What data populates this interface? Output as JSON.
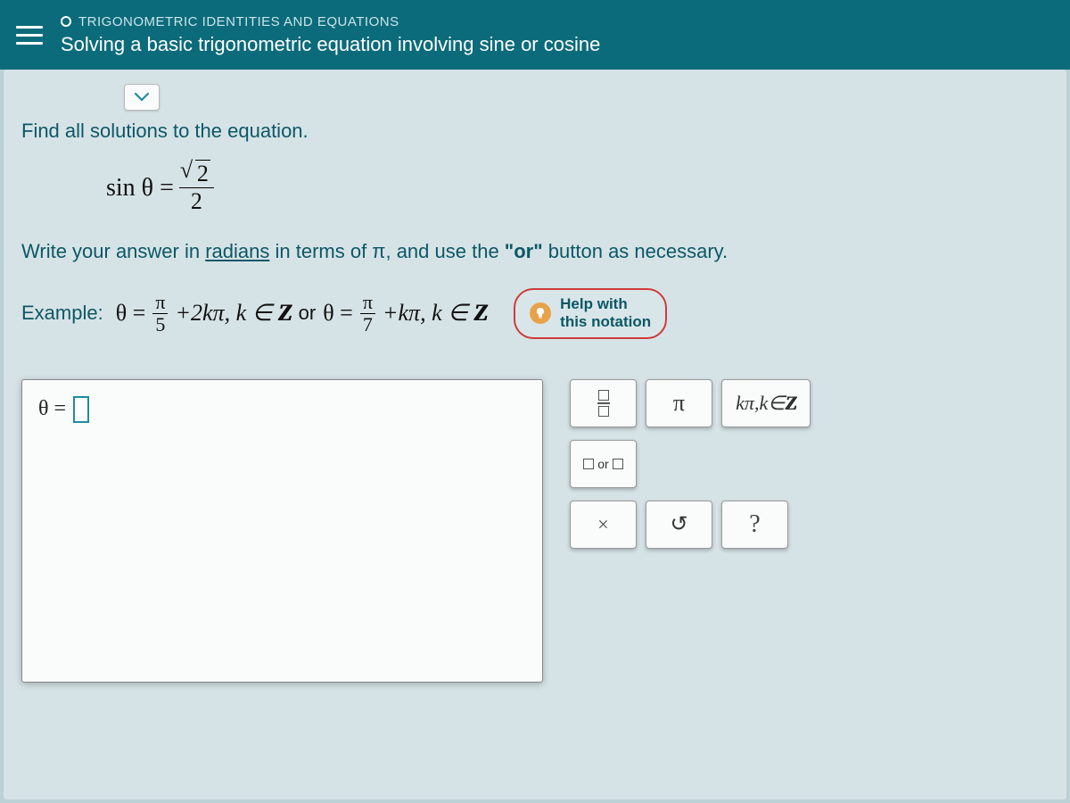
{
  "header": {
    "breadcrumb": "TRIGONOMETRIC IDENTITIES AND EQUATIONS",
    "title": "Solving a basic trigonometric equation involving sine or cosine"
  },
  "instruction1": "Find all solutions to the equation.",
  "equation": {
    "lhs": "sin θ =",
    "num_radicand": "2",
    "den": "2"
  },
  "instruction2": {
    "pre": "Write your answer in ",
    "link": "radians",
    "mid": " in terms of π, and use the ",
    "bold": "\"or\"",
    "post": " button as necessary."
  },
  "example": {
    "label": "Example:",
    "part1_pre": "θ =",
    "frac1_n": "π",
    "frac1_d": "5",
    "part1_post": "+2kπ, k ∈",
    "z1": "Z",
    "or": "or",
    "part2_pre": "θ =",
    "frac2_n": "π",
    "frac2_d": "7",
    "part2_post": "+kπ, k ∈",
    "z2": "Z"
  },
  "help": {
    "line1": "Help with",
    "line2": "this notation"
  },
  "answer": {
    "prefix": "θ ="
  },
  "keypad": {
    "pi": "π",
    "kpi": "kπ,k∈",
    "kz": "Z",
    "or": "or",
    "clear": "×",
    "undo": "↺",
    "help": "?"
  }
}
